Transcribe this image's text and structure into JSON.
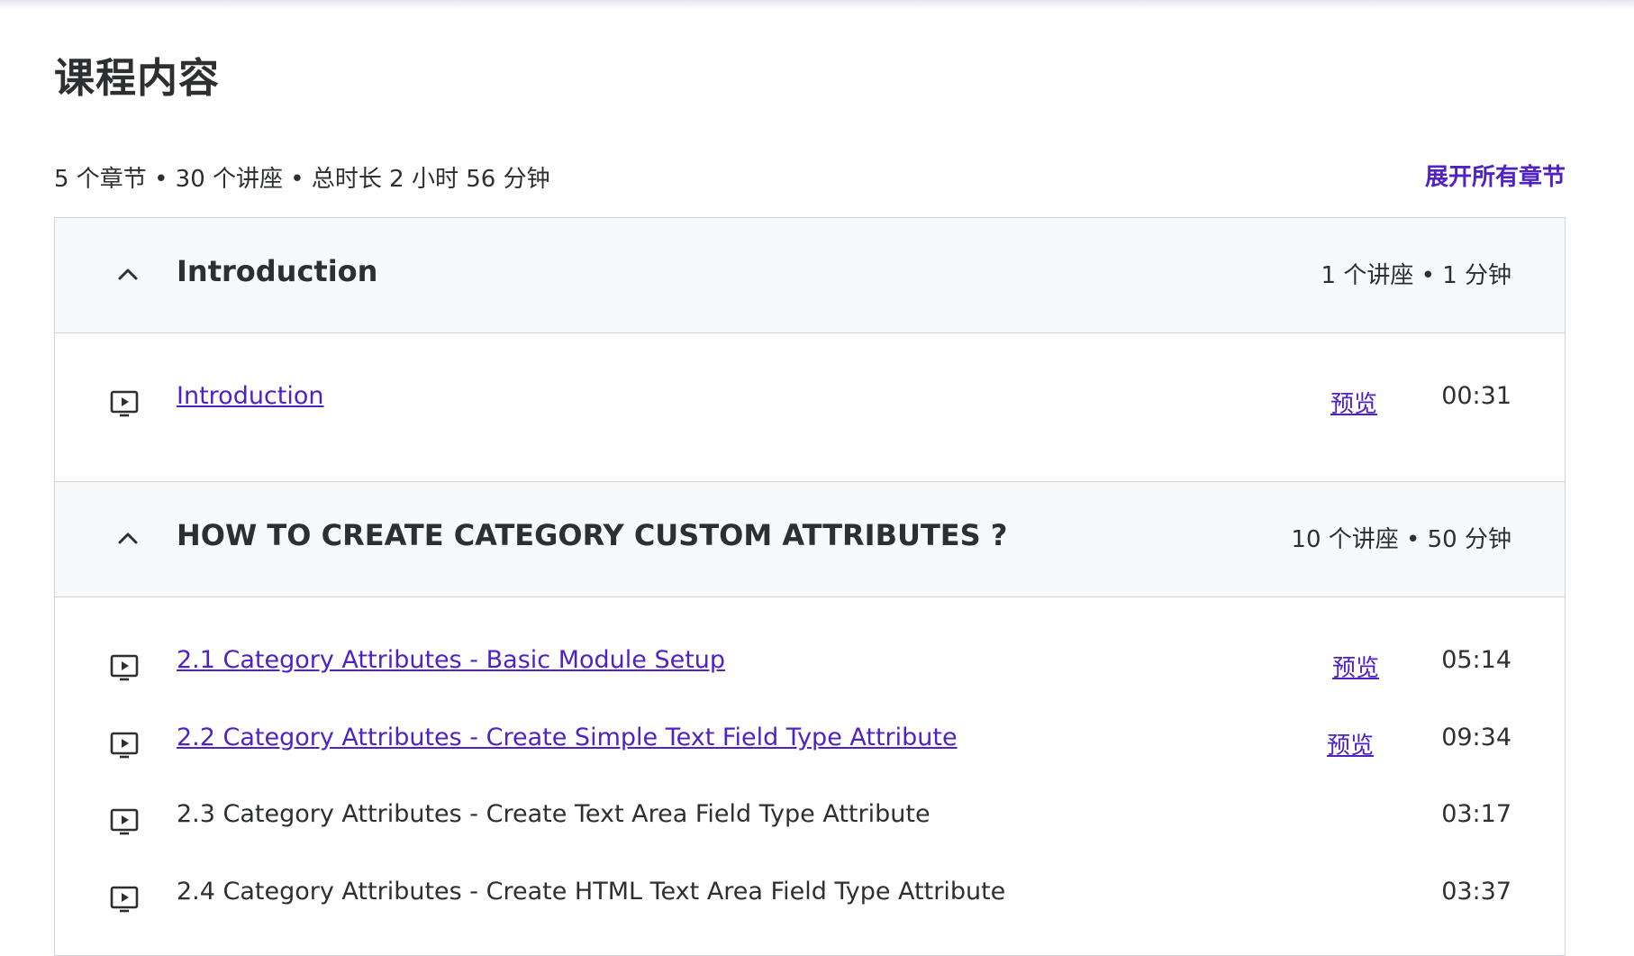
{
  "page_title": "课程内容",
  "summary": "5 个章节 • 30 个讲座 • 总时长 2 小时 56 分钟",
  "expand_all_label": "展开所有章节",
  "colors": {
    "link": "#5022c3",
    "text": "#2d2f31",
    "section_bg": "#f7f9fa",
    "border": "#d1d2e0"
  },
  "sections": [
    {
      "title": "Introduction",
      "meta": "1 个讲座 • 1 分钟",
      "icon": "chevron-up-icon",
      "lectures": [
        {
          "title": "Introduction",
          "preview": "预览",
          "duration": "00:31",
          "icon": "video-play-icon"
        }
      ]
    },
    {
      "title": "HOW TO CREATE CATEGORY CUSTOM ATTRIBUTES ?",
      "meta": "10 个讲座 • 50 分钟",
      "icon": "chevron-up-icon",
      "lectures": [
        {
          "title": "2.1 Category Attributes - Basic Module Setup",
          "preview": "预览",
          "duration": "05:14",
          "icon": "video-play-icon"
        },
        {
          "title": "2.2 Category Attributes - Create Simple Text Field Type Attribute",
          "preview": "预览",
          "duration": "09:34",
          "icon": "video-play-icon"
        },
        {
          "title": "2.3 Category Attributes - Create Text Area Field Type Attribute",
          "duration": "03:17",
          "icon": "video-play-icon"
        },
        {
          "title": "2.4 Category Attributes - Create HTML Text Area Field Type Attribute",
          "duration": "03:37",
          "icon": "video-play-icon"
        }
      ]
    }
  ]
}
